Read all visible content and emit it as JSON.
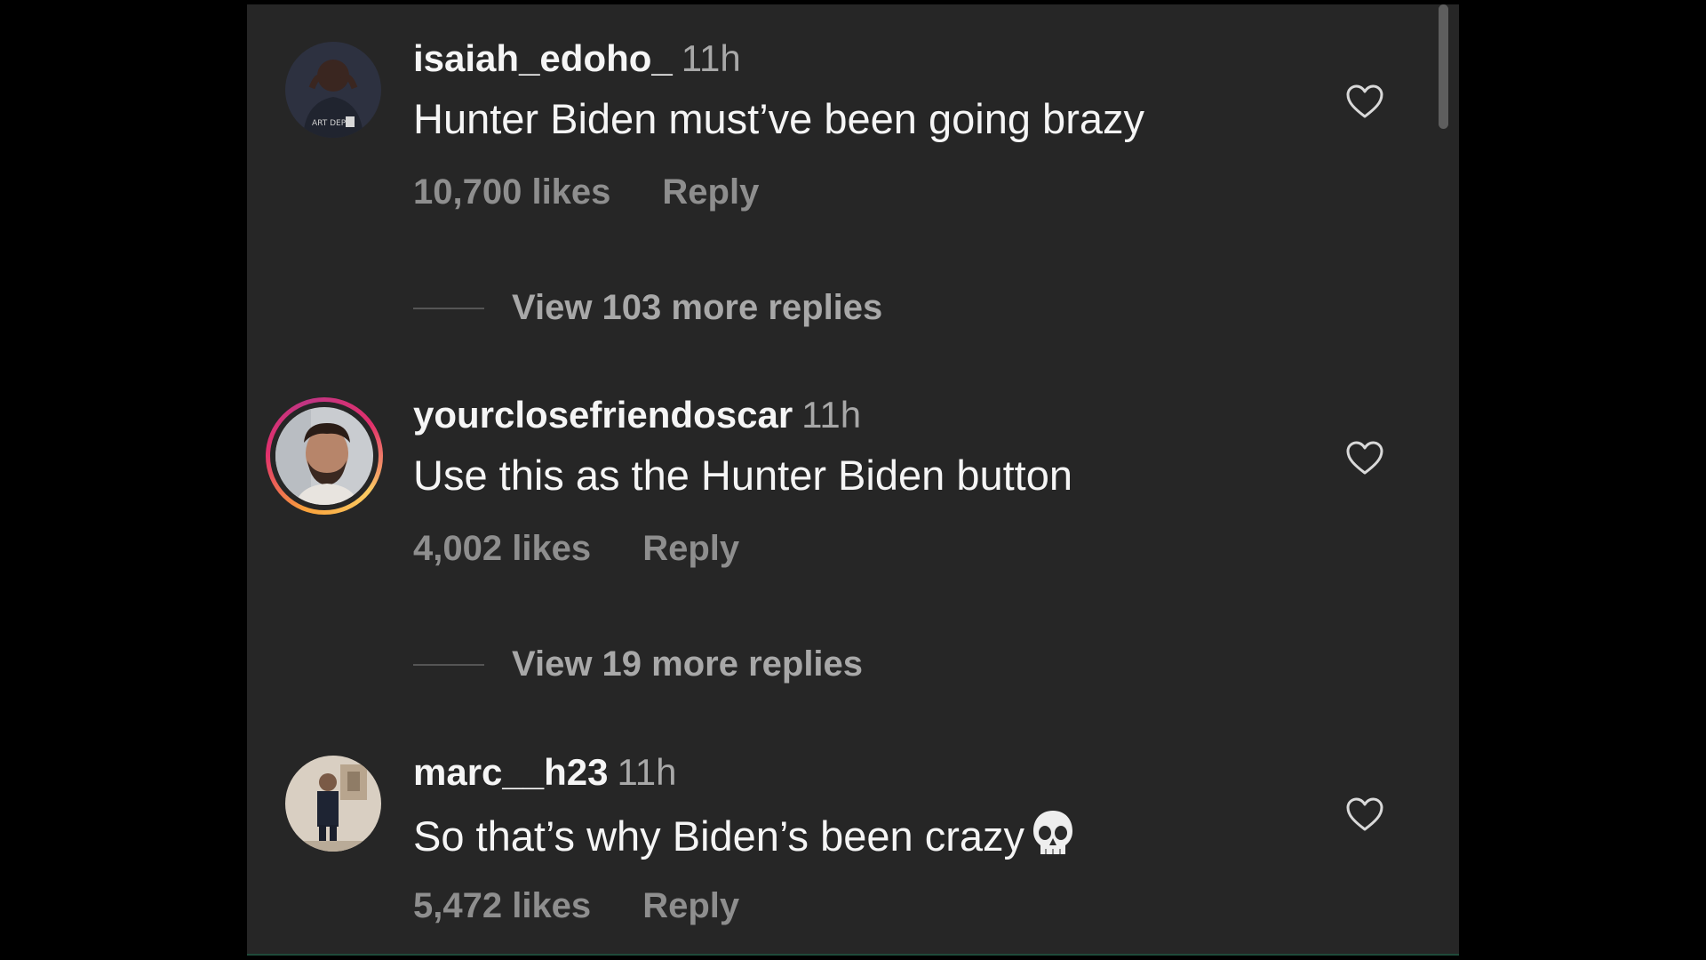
{
  "comments": [
    {
      "username": "isaiah_edoho_",
      "time": "11h",
      "text": "Hunter Biden must’ve been going brazy",
      "likes": "10,700 likes",
      "reply": "Reply",
      "view_replies": "View 103 more replies",
      "avatar_text": "ART DEPT."
    },
    {
      "username": "yourclosefriendoscar",
      "time": "11h",
      "text": "Use this as the Hunter Biden button",
      "likes": "4,002 likes",
      "reply": "Reply",
      "view_replies": "View 19 more replies"
    },
    {
      "username": "marc__h23",
      "time": "11h",
      "text": "So that’s why Biden’s been crazy",
      "emoji": "skull-emoji",
      "likes": "5,472 likes",
      "reply": "Reply"
    }
  ],
  "icons": {
    "like": "heart-outline-icon"
  },
  "colors": {
    "background": "#262626",
    "username": "#f5f5f5",
    "secondary": "#a8a8a8",
    "story_ring": [
      "#f9a13b",
      "#e1306c",
      "#c13584"
    ]
  }
}
